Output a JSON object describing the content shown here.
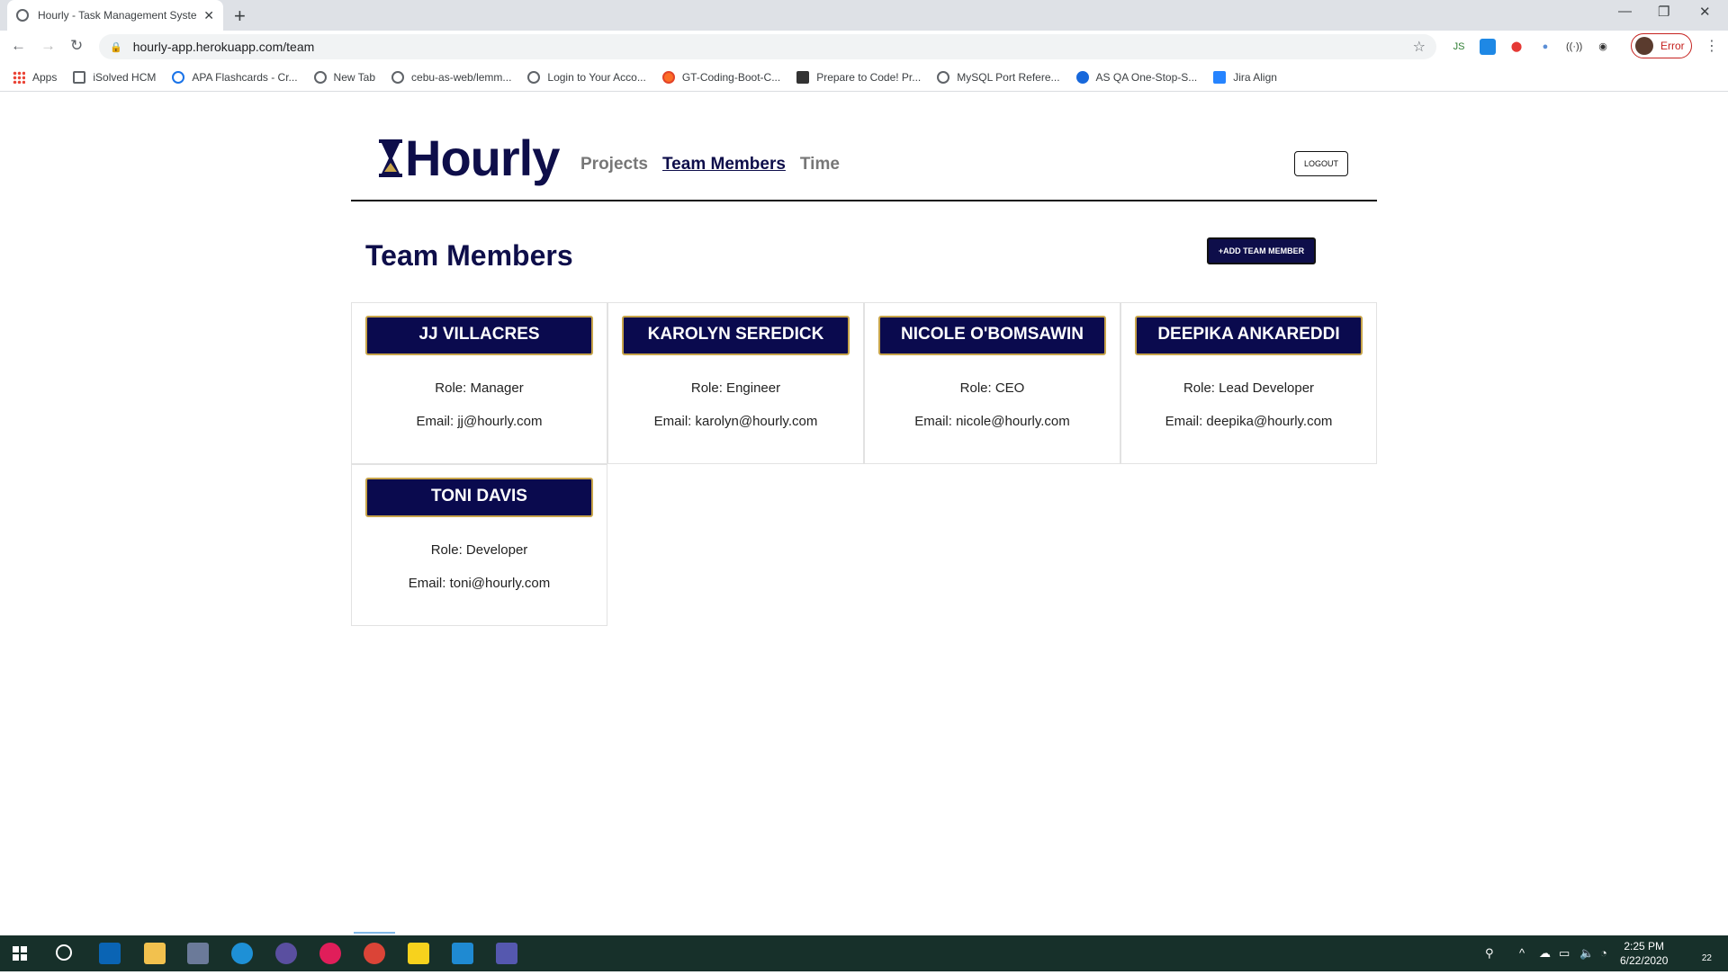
{
  "browser": {
    "tab_title": "Hourly - Task Management Syste",
    "url": "hourly-app.herokuapp.com/team",
    "profile_label": "Error",
    "bookmarks": [
      {
        "label": "Apps",
        "icon": "apps-grid-icon"
      },
      {
        "label": "iSolved HCM",
        "icon": "page-icon"
      },
      {
        "label": "APA Flashcards - Cr...",
        "icon": "globe-icon"
      },
      {
        "label": "New Tab",
        "icon": "globe-icon"
      },
      {
        "label": "cebu-as-web/lemm...",
        "icon": "globe-icon"
      },
      {
        "label": "Login to Your Acco...",
        "icon": "globe-icon"
      },
      {
        "label": "GT-Coding-Boot-C...",
        "icon": "gitlab-icon"
      },
      {
        "label": "Prepare to Code! Pr...",
        "icon": "book-icon"
      },
      {
        "label": "MySQL Port Refere...",
        "icon": "globe-icon"
      },
      {
        "label": "AS QA One-Stop-S...",
        "icon": "confluence-icon"
      },
      {
        "label": "Jira Align",
        "icon": "jira-icon"
      }
    ]
  },
  "app": {
    "logo_text": "Hourly",
    "nav": {
      "projects": "Projects",
      "team": "Team Members",
      "time": "Time"
    },
    "logout_label": "LOGOUT",
    "page_title": "Team Members",
    "add_button_label": "+ADD TEAM MEMBER",
    "members": [
      {
        "name": "JJ VILLACRES",
        "role": "Role: Manager",
        "email": "Email: jj@hourly.com"
      },
      {
        "name": "KAROLYN SEREDICK",
        "role": "Role: Engineer",
        "email": "Email: karolyn@hourly.com"
      },
      {
        "name": "NICOLE O'BOMSAWIN",
        "role": "Role: CEO",
        "email": "Email: nicole@hourly.com"
      },
      {
        "name": "DEEPIKA ANKAREDDI",
        "role": "Role: Lead Developer",
        "email": "Email: deepika@hourly.com"
      },
      {
        "name": "TONI DAVIS",
        "role": "Role: Developer",
        "email": "Email: toni@hourly.com"
      }
    ]
  },
  "taskbar": {
    "time": "2:25 PM",
    "date": "6/22/2020",
    "notifications": "22"
  },
  "colors": {
    "brand_navy": "#0e0e4a",
    "card_border_gold": "#c7a44a",
    "taskbar": "#17302a"
  }
}
